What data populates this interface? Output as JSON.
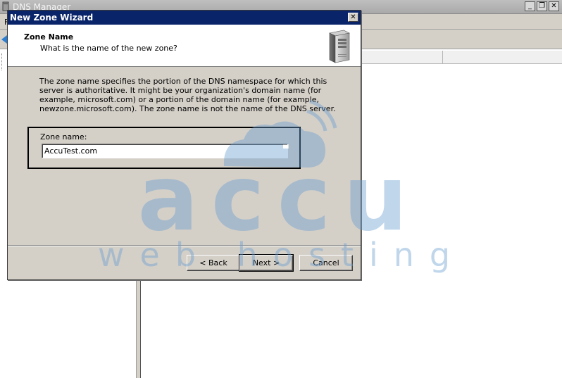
{
  "background_window": {
    "title": "DNS Manager",
    "menu_first": "F",
    "controls": {
      "minimize": "_",
      "restore": "❐",
      "close": "✕"
    }
  },
  "dialog": {
    "title": "New Zone Wizard",
    "close_glyph": "✕",
    "header": {
      "title": "Zone Name",
      "subtitle": "What is the name of the new zone?",
      "icon": "server-icon"
    },
    "description": "The zone name specifies the portion of the DNS namespace for which this server is authoritative. It might be your organization's domain name (for example,  microsoft.com) or a portion of the domain name (for example, newzone.microsoft.com). The zone name is not the name of the DNS server.",
    "zone_name": {
      "label": "Zone name:",
      "value": "AccuTest.com"
    },
    "buttons": {
      "back": "< Back",
      "next": "Next >",
      "cancel": "Cancel"
    }
  },
  "watermark": {
    "brand": "accu",
    "tagline": "web hosting",
    "color": "#6a9ed0"
  },
  "colors": {
    "dialog_titlebar": "#0a246a",
    "dialog_face": "#d4d0c8",
    "header_bg": "#ffffff"
  }
}
